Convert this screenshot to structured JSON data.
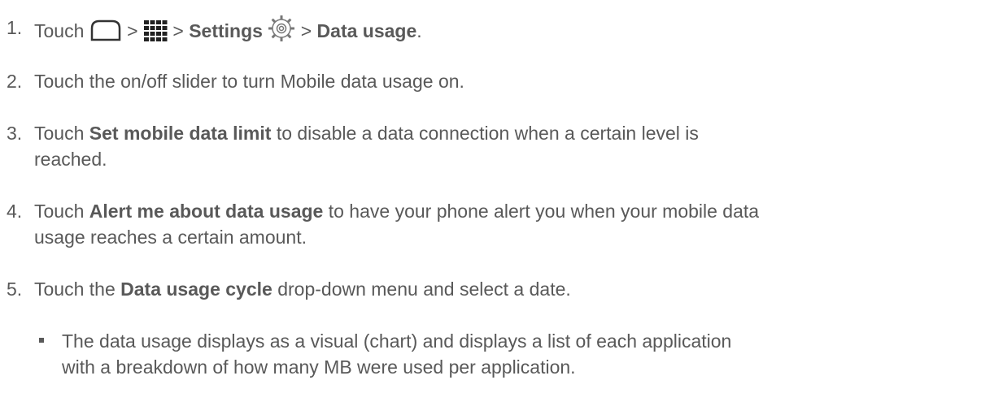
{
  "steps": [
    {
      "number": "1.",
      "parts": {
        "touch": "Touch",
        "sep1": ">",
        "sep2": ">",
        "settings": "Settings",
        "sep3": ">",
        "data_usage": "Data usage",
        "end": "."
      },
      "icons": [
        "home-icon",
        "apps-grid-icon",
        "settings-gear-icon"
      ]
    },
    {
      "number": "2.",
      "text": "Touch the on/off slider to turn Mobile data usage on."
    },
    {
      "number": "3.",
      "pre": "Touch",
      "bold": "Set mobile data limit",
      "post": "to disable a data connection when a certain level is",
      "post2": "reached."
    },
    {
      "number": "4.",
      "pre": "Touch",
      "bold": "Alert me about data usage",
      "post": "to have your phone alert you when your mobile data",
      "post2": "usage reaches a certain amount."
    },
    {
      "number": "5.",
      "pre": "Touch the",
      "bold": "Data usage cycle",
      "post": "drop-down menu and select a date."
    }
  ],
  "bullet": {
    "line1": "The data usage displays as a visual (chart) and displays a list of each application",
    "line2": "with a breakdown of how many MB were used per application."
  },
  "colors": {
    "text": "#595959",
    "icon": "#333333"
  }
}
